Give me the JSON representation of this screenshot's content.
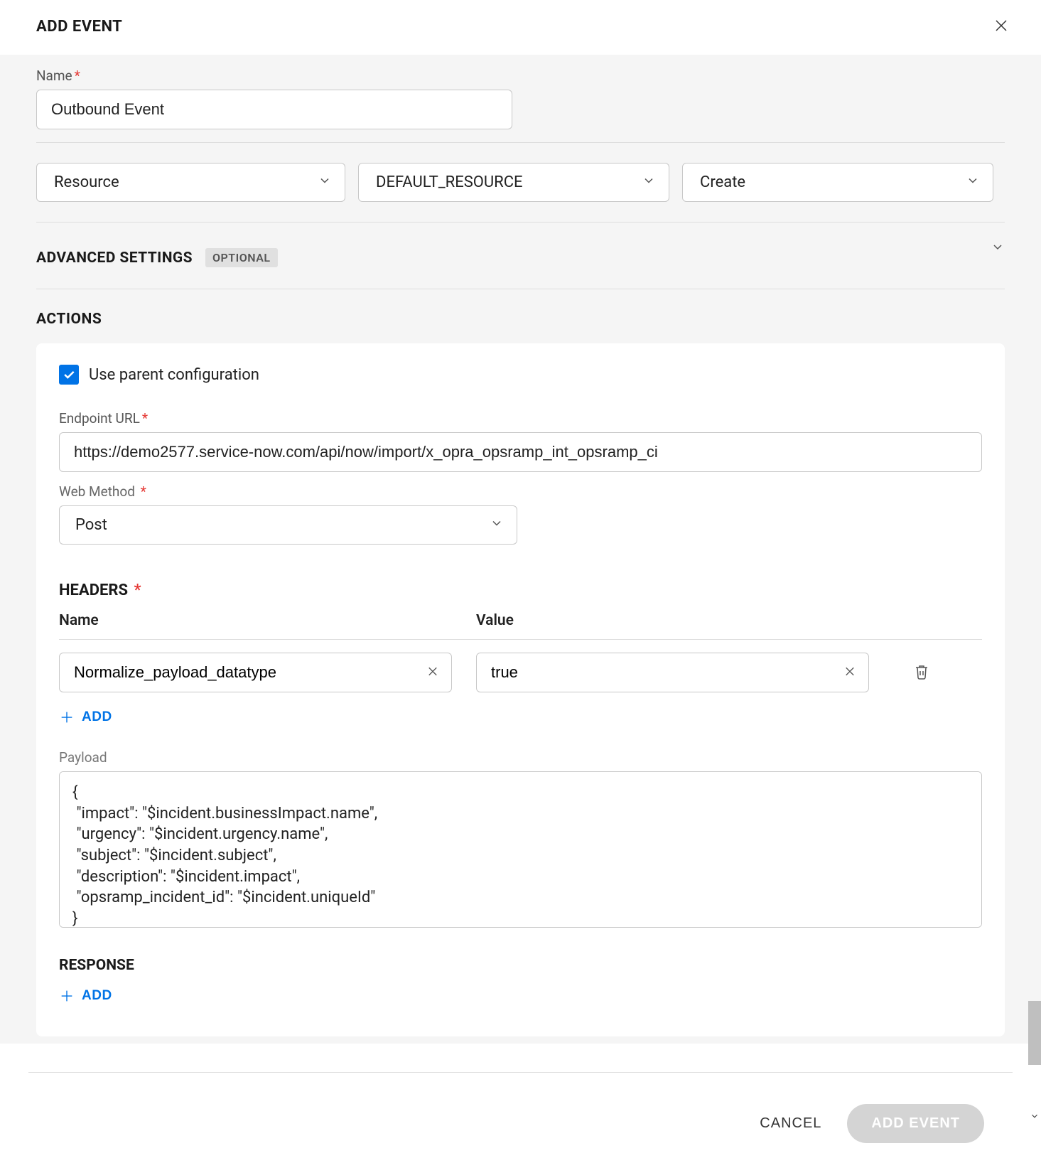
{
  "header": {
    "title": "ADD EVENT"
  },
  "name": {
    "label": "Name",
    "value": "Outbound Event"
  },
  "selects": {
    "s1": "Resource",
    "s2": "DEFAULT_RESOURCE",
    "s3": "Create"
  },
  "advanced": {
    "title": "ADVANCED SETTINGS",
    "badge": "OPTIONAL"
  },
  "actions": {
    "title": "ACTIONS",
    "useParentLabel": "Use parent configuration",
    "useParentChecked": true,
    "endpoint": {
      "label": "Endpoint URL",
      "value": "https://demo2577.service-now.com/api/now/import/x_opra_opsramp_int_opsramp_ci"
    },
    "webMethod": {
      "label": "Web Method",
      "value": "Post"
    },
    "headers": {
      "title": "HEADERS",
      "colName": "Name",
      "colValue": "Value",
      "rows": [
        {
          "name": "Normalize_payload_datatype",
          "value": "true"
        }
      ],
      "addLabel": "ADD"
    },
    "payload": {
      "label": "Payload",
      "value": "{\n \"impact\": \"$incident.businessImpact.name\",\n \"urgency\": \"$incident.urgency.name\",\n \"subject\": \"$incident.subject\",\n \"description\": \"$incident.impact\",\n \"opsramp_incident_id\": \"$incident.uniqueId\"\n}"
    },
    "response": {
      "title": "RESPONSE",
      "addLabel": "ADD"
    }
  },
  "footer": {
    "cancel": "CANCEL",
    "submit": "ADD EVENT"
  }
}
